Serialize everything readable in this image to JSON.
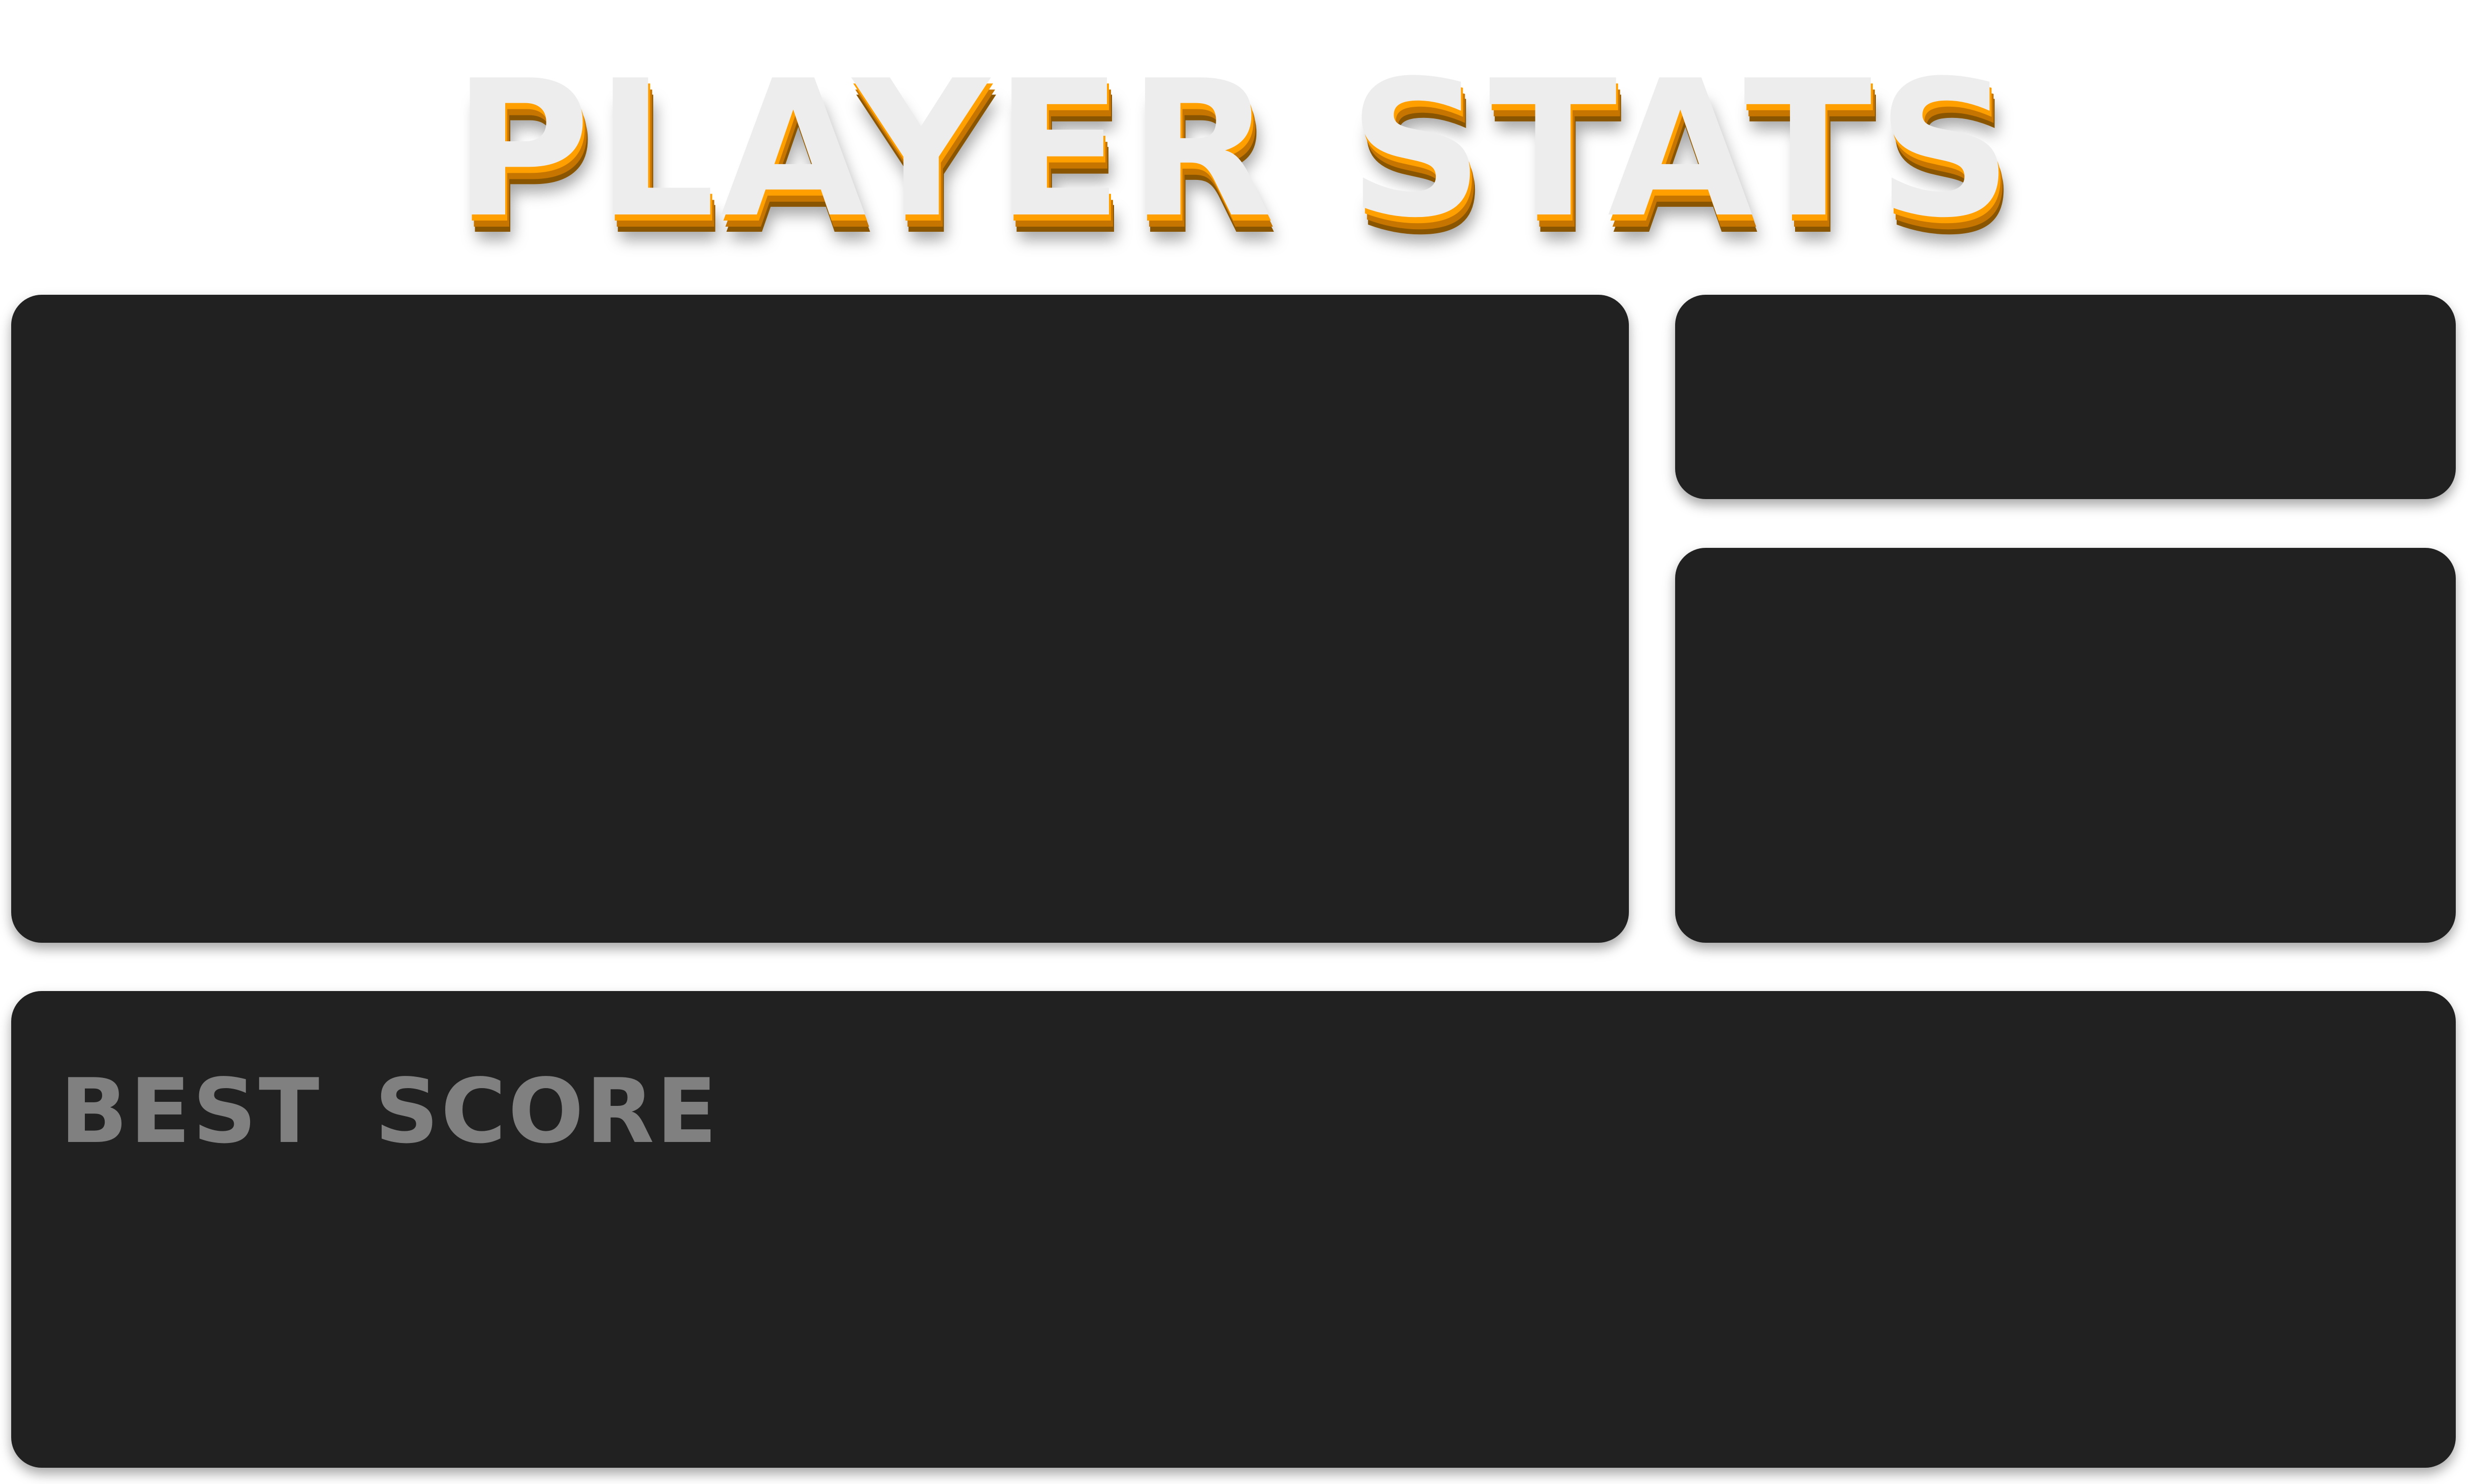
{
  "header": {
    "title": "PLAYER STATS"
  },
  "panels": {
    "best_score": {
      "label": "BEST SCORE"
    }
  },
  "colors": {
    "background": "#ffffff",
    "panel": "#212121",
    "title_fill": "#ededed",
    "title_accent": "#ffa000",
    "label": "#808080"
  }
}
